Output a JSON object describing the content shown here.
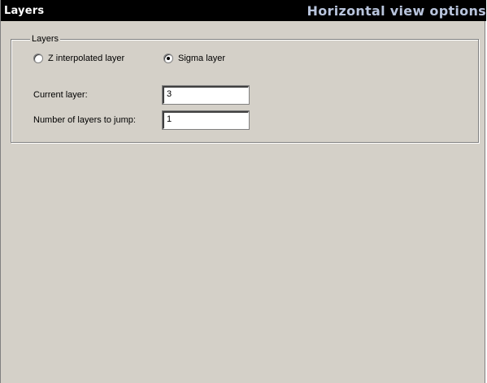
{
  "header": {
    "title": "Layers",
    "section": "Horizontal view options"
  },
  "layers_group": {
    "legend": "Layers",
    "radio_options": [
      {
        "label": "Z interpolated layer",
        "checked": false
      },
      {
        "label": "Sigma layer",
        "checked": true
      }
    ],
    "current_layer_label": "Current layer:",
    "current_layer_value": "3",
    "jump_label": "Number of layers to jump:",
    "jump_value": "1"
  },
  "colors": {
    "header_bg": "#000000",
    "header_text": "#ffffff",
    "header_section_text": "#b8c4dc",
    "panel_bg": "#d4d0c8"
  }
}
